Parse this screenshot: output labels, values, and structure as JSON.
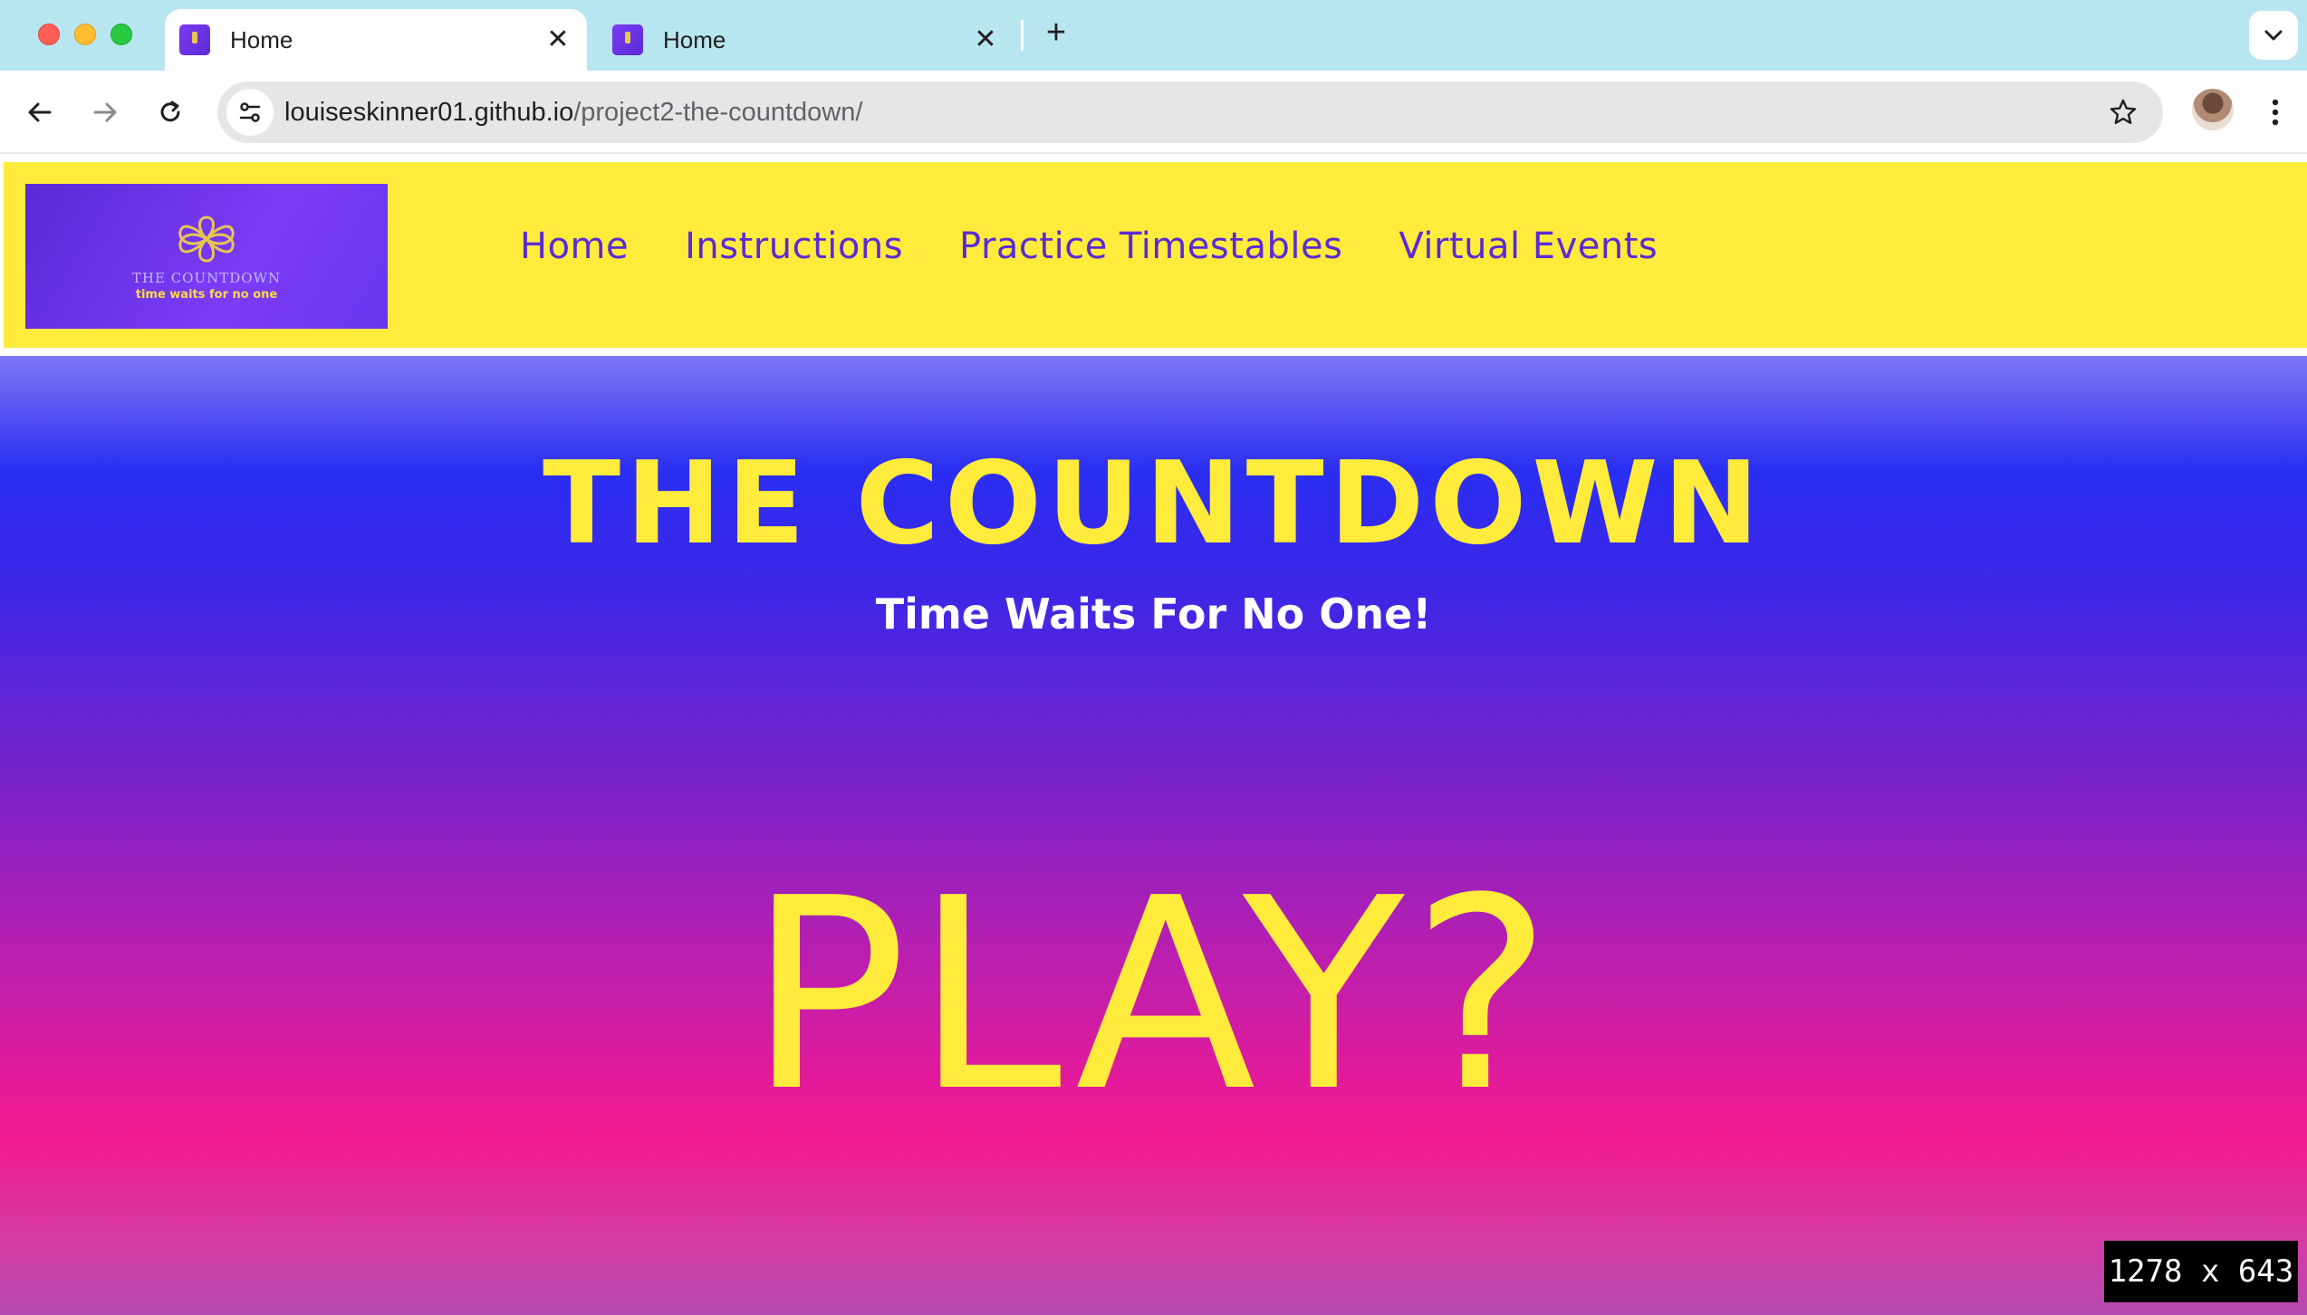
{
  "browser": {
    "tabs": [
      {
        "title": "Home",
        "close": "✕",
        "active": true
      },
      {
        "title": "Home",
        "close": "✕",
        "active": false
      }
    ],
    "new_tab": "+",
    "url_host": "louiseskinner01.github.io",
    "url_path": "/project2-the-countdown/"
  },
  "site": {
    "logo": {
      "line1": "THE COUNTDOWN",
      "line2": "time waits for no one"
    },
    "nav": [
      "Home",
      "Instructions",
      "Practice Timestables",
      "Virtual Events"
    ],
    "hero": {
      "title": "THE COUNTDOWN",
      "subtitle": "Time Waits For No One!",
      "play": "PLAY?"
    }
  },
  "viewport_badge": "1278 x 643",
  "colors": {
    "nav_background": "#ffeb3b",
    "accent_yellow": "#ffeb3b",
    "link_purple": "#5b2ad6",
    "tab_bar": "#b8e6f0"
  }
}
